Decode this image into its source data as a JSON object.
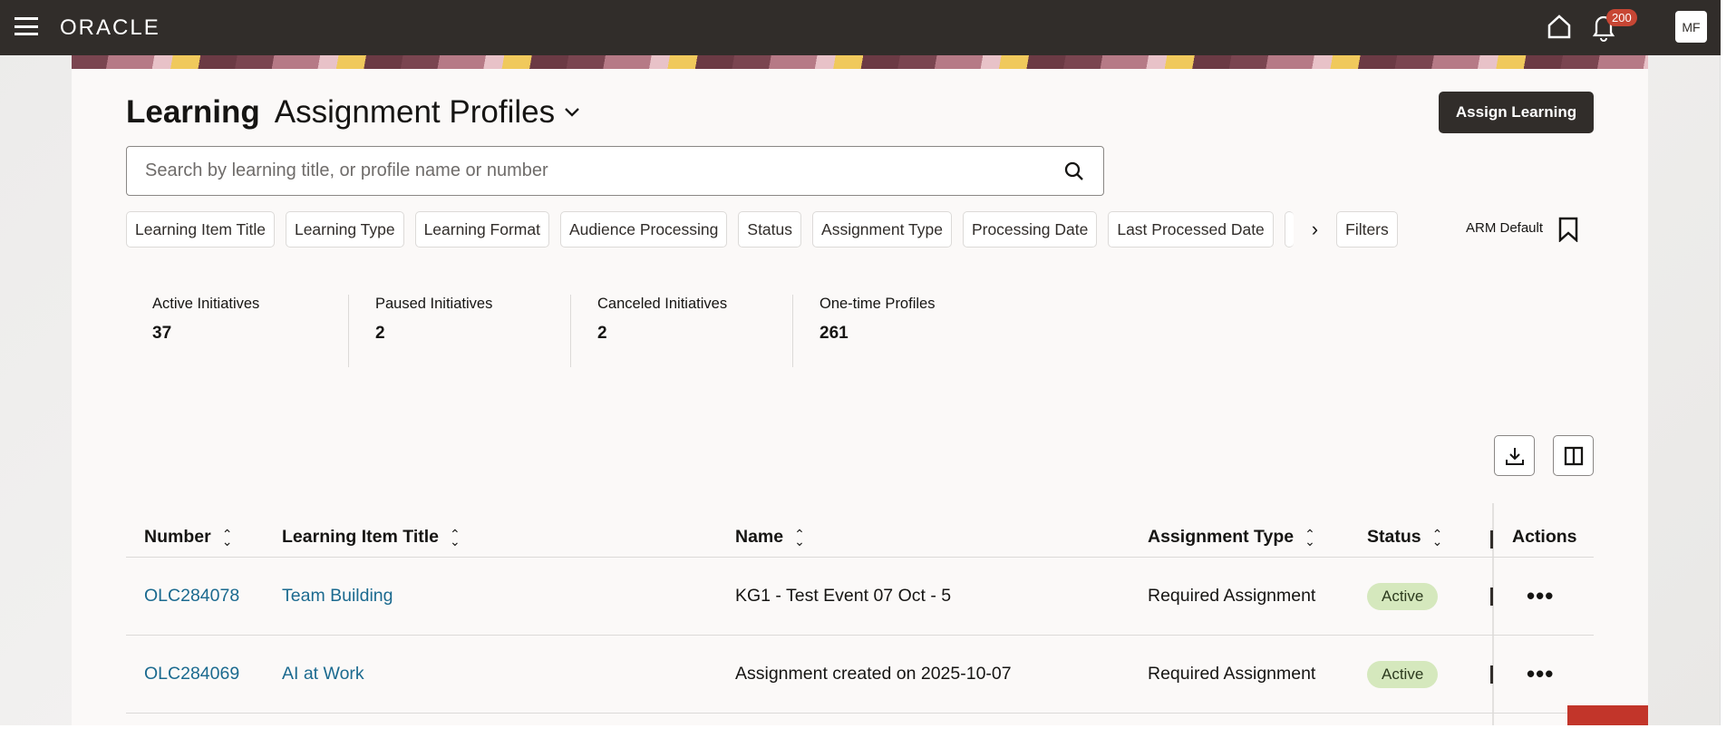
{
  "topbar": {
    "logo": "ORACLE",
    "notification_count": "200",
    "avatar_initials": "MF"
  },
  "header": {
    "title_bold": "Learning",
    "title": "Assignment Profiles",
    "assign_button": "Assign Learning"
  },
  "search": {
    "placeholder": "Search by learning title, or profile name or number"
  },
  "filters": {
    "chips": [
      "Learning Item Title",
      "Learning Type",
      "Learning Format",
      "Audience Processing",
      "Status",
      "Assignment Type",
      "Processing Date",
      "Last Processed Date"
    ],
    "filters_label": "Filters",
    "saved_search": "ARM Default"
  },
  "stats": [
    {
      "label": "Active Initiatives",
      "value": "37"
    },
    {
      "label": "Paused Initiatives",
      "value": "2"
    },
    {
      "label": "Canceled Initiatives",
      "value": "2"
    },
    {
      "label": "One-time Profiles",
      "value": "261"
    }
  ],
  "table": {
    "columns": [
      "Number",
      "Learning Item Title",
      "Name",
      "Assignment Type",
      "Status",
      "Actions"
    ],
    "rows": [
      {
        "number": "OLC284078",
        "title": "Team Building",
        "name": "KG1 - Test Event 07 Oct - 5",
        "type": "Required Assignment",
        "status": "Active"
      },
      {
        "number": "OLC284069",
        "title": "AI at Work",
        "name": "Assignment created on 2025-10-07",
        "type": "Required Assignment",
        "status": "Active"
      }
    ]
  },
  "colors": {
    "topbar": "#312d2a",
    "link": "#1b6a8f",
    "active_pill": "#d5e8bd",
    "badge": "#c74634"
  }
}
